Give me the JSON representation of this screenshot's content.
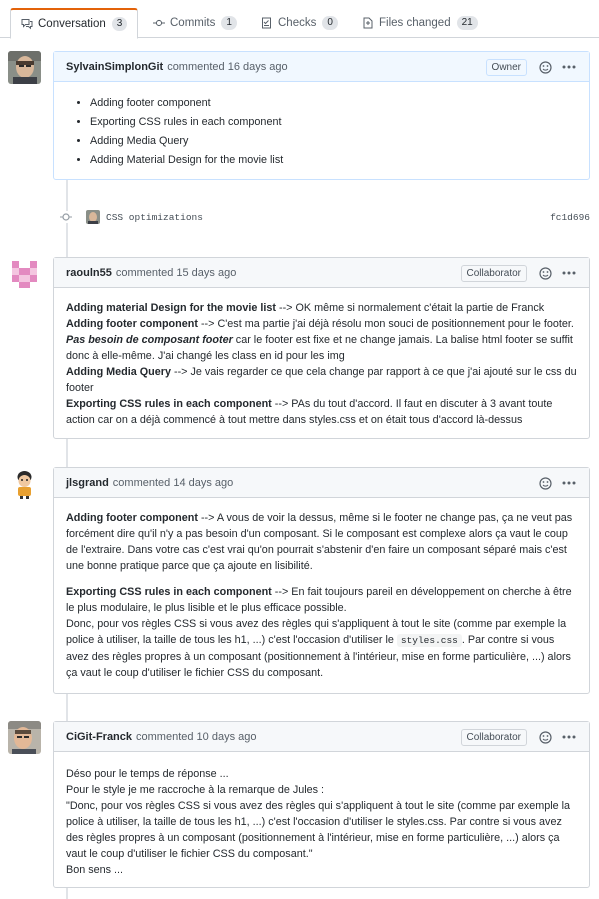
{
  "tabs": [
    {
      "label": "Conversation",
      "count": "3"
    },
    {
      "label": "Commits",
      "count": "1"
    },
    {
      "label": "Checks",
      "count": "0"
    },
    {
      "label": "Files changed",
      "count": "21"
    }
  ],
  "comments": [
    {
      "author": "SylvainSimplonGit",
      "meta": "commented 16 days ago",
      "role": "Owner",
      "items": [
        "Adding footer component",
        "Exporting CSS rules in each component",
        "Adding Media Query",
        "Adding Material Design for the movie list"
      ]
    },
    {
      "author": "raouln55",
      "meta": "commented 15 days ago",
      "role": "Collaborator",
      "p1_b": "Adding material Design for the movie list",
      "p1_t": " --> OK même si normalement c'était la partie de Franck",
      "p2_b": "Adding footer component",
      "p2_t1": " --> C'est ma partie j'ai déjà résolu mon souci de positionnement pour le footer. ",
      "p2_i": "Pas besoin de composant footer",
      "p2_t2": " car le footer est fixe et ne change jamais. La balise html footer se suffit donc à elle-même. J'ai changé les class en id pour les img",
      "p3_b": "Adding Media Query",
      "p3_t": " --> Je vais regarder ce que cela change par rapport à ce que j'ai ajouté sur le css du footer",
      "p4_b": "Exporting CSS rules in each component",
      "p4_t": " --> PAs du tout d'accord. Il faut en discuter à 3 avant toute action car on a déjà commencé à tout mettre dans styles.css et on était tous d'accord là-dessus"
    },
    {
      "author": "jlsgrand",
      "meta": "commented 14 days ago",
      "p1_b": "Adding footer component",
      "p1_t": " --> A vous de voir la dessus, même si le footer ne change pas, ça ne veut pas forcément dire qu'il n'y a pas besoin d'un composant. Si le composant est complexe alors ça vaut le coup de l'extraire. Dans votre cas c'est vrai qu'on pourrait s'abstenir d'en faire un composant séparé mais c'est une bonne pratique parce que ça ajoute en lisibilité.",
      "p2_b": "Exporting CSS rules in each component",
      "p2_t1": " --> En fait toujours pareil en développement on cherche à être le plus modulaire, le plus lisible et le plus efficace possible.",
      "p2_t2": "Donc, pour vos règles CSS si vous avez des règles qui s'appliquent à tout le site (comme par exemple la police à utiliser, la taille de tous les h1, ...) c'est l'occasion d'utiliser le ",
      "p2_code": "styles.css",
      "p2_t3": ". Par contre si vous avez des règles propres à un composant (positionnement à l'intérieur, mise en forme particulière, ...) alors ça vaut le coup d'utiliser le fichier CSS du composant."
    },
    {
      "author": "CiGit-Franck",
      "meta": "commented 10 days ago",
      "role": "Collaborator",
      "l1": "Déso pour le temps de réponse ...",
      "l2": "Pour le style je me raccroche à la remarque de Jules :",
      "l3": "\"Donc, pour vos règles CSS si vous avez des règles qui s'appliquent à tout le site (comme par exemple la police à utiliser, la taille de tous les h1, ...) c'est l'occasion d'utiliser le styles.css. Par contre si vous avez des règles propres à un composant (positionnement à l'intérieur, mise en forme particulière, ...) alors ça vaut le coup d'utiliser le fichier CSS du composant.\"",
      "l4": "Bon sens ..."
    }
  ],
  "commit": {
    "message": "CSS optimizations",
    "sha": "fc1d696"
  },
  "colors": {
    "active_tab_accent": "#e36209",
    "owner_header": "#f1f8ff",
    "owner_border": "#c8e1ff"
  }
}
